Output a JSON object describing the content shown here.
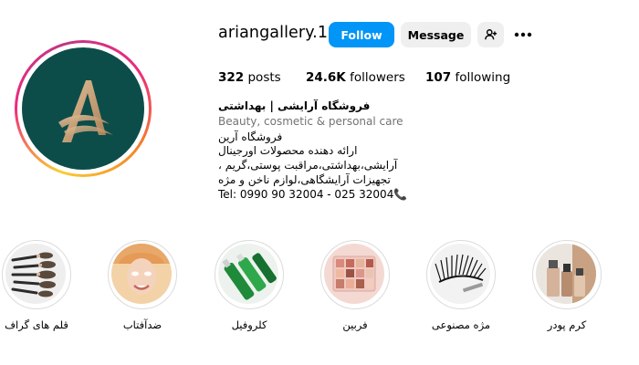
{
  "profile": {
    "username": "ariangallery.1",
    "follow_label": "Follow",
    "message_label": "Message"
  },
  "stats": {
    "posts_count": "322",
    "posts_label": "posts",
    "followers_count": "24.6K",
    "followers_label": "followers",
    "following_count": "107",
    "following_label": "following"
  },
  "bio": {
    "name": "فروشگاه آرایشی | بهداشتی",
    "category": "Beauty, cosmetic & personal care",
    "lines": [
      "فروشگاه آرین",
      "ارائه دهنده محصولات اورجینال",
      "آرایشی،بهداشتی،مراقبت پوستی،گریم ،",
      "تجهیزات آرایشگاهی،لوازم ناخن و مژه",
      "Tel: 0990 90 32004 - 025 32004📞"
    ]
  },
  "highlights": [
    {
      "label": "قلم های گراف",
      "icon": "brushes-icon"
    },
    {
      "label": "ضدآفتاب",
      "icon": "sunscreen-model-icon"
    },
    {
      "label": "کلروفیل",
      "icon": "chlorophyll-bottles-icon"
    },
    {
      "label": "فربین",
      "icon": "eyeshadow-palette-icon"
    },
    {
      "label": "مژه مصنوعی",
      "icon": "false-eyelash-icon"
    },
    {
      "label": "کرم پودر",
      "icon": "foundation-bottles-icon"
    }
  ],
  "colors": {
    "accent": "#0095f6",
    "logo_bg": "#0c4d4a",
    "logo_gold": "#c9a27a"
  }
}
